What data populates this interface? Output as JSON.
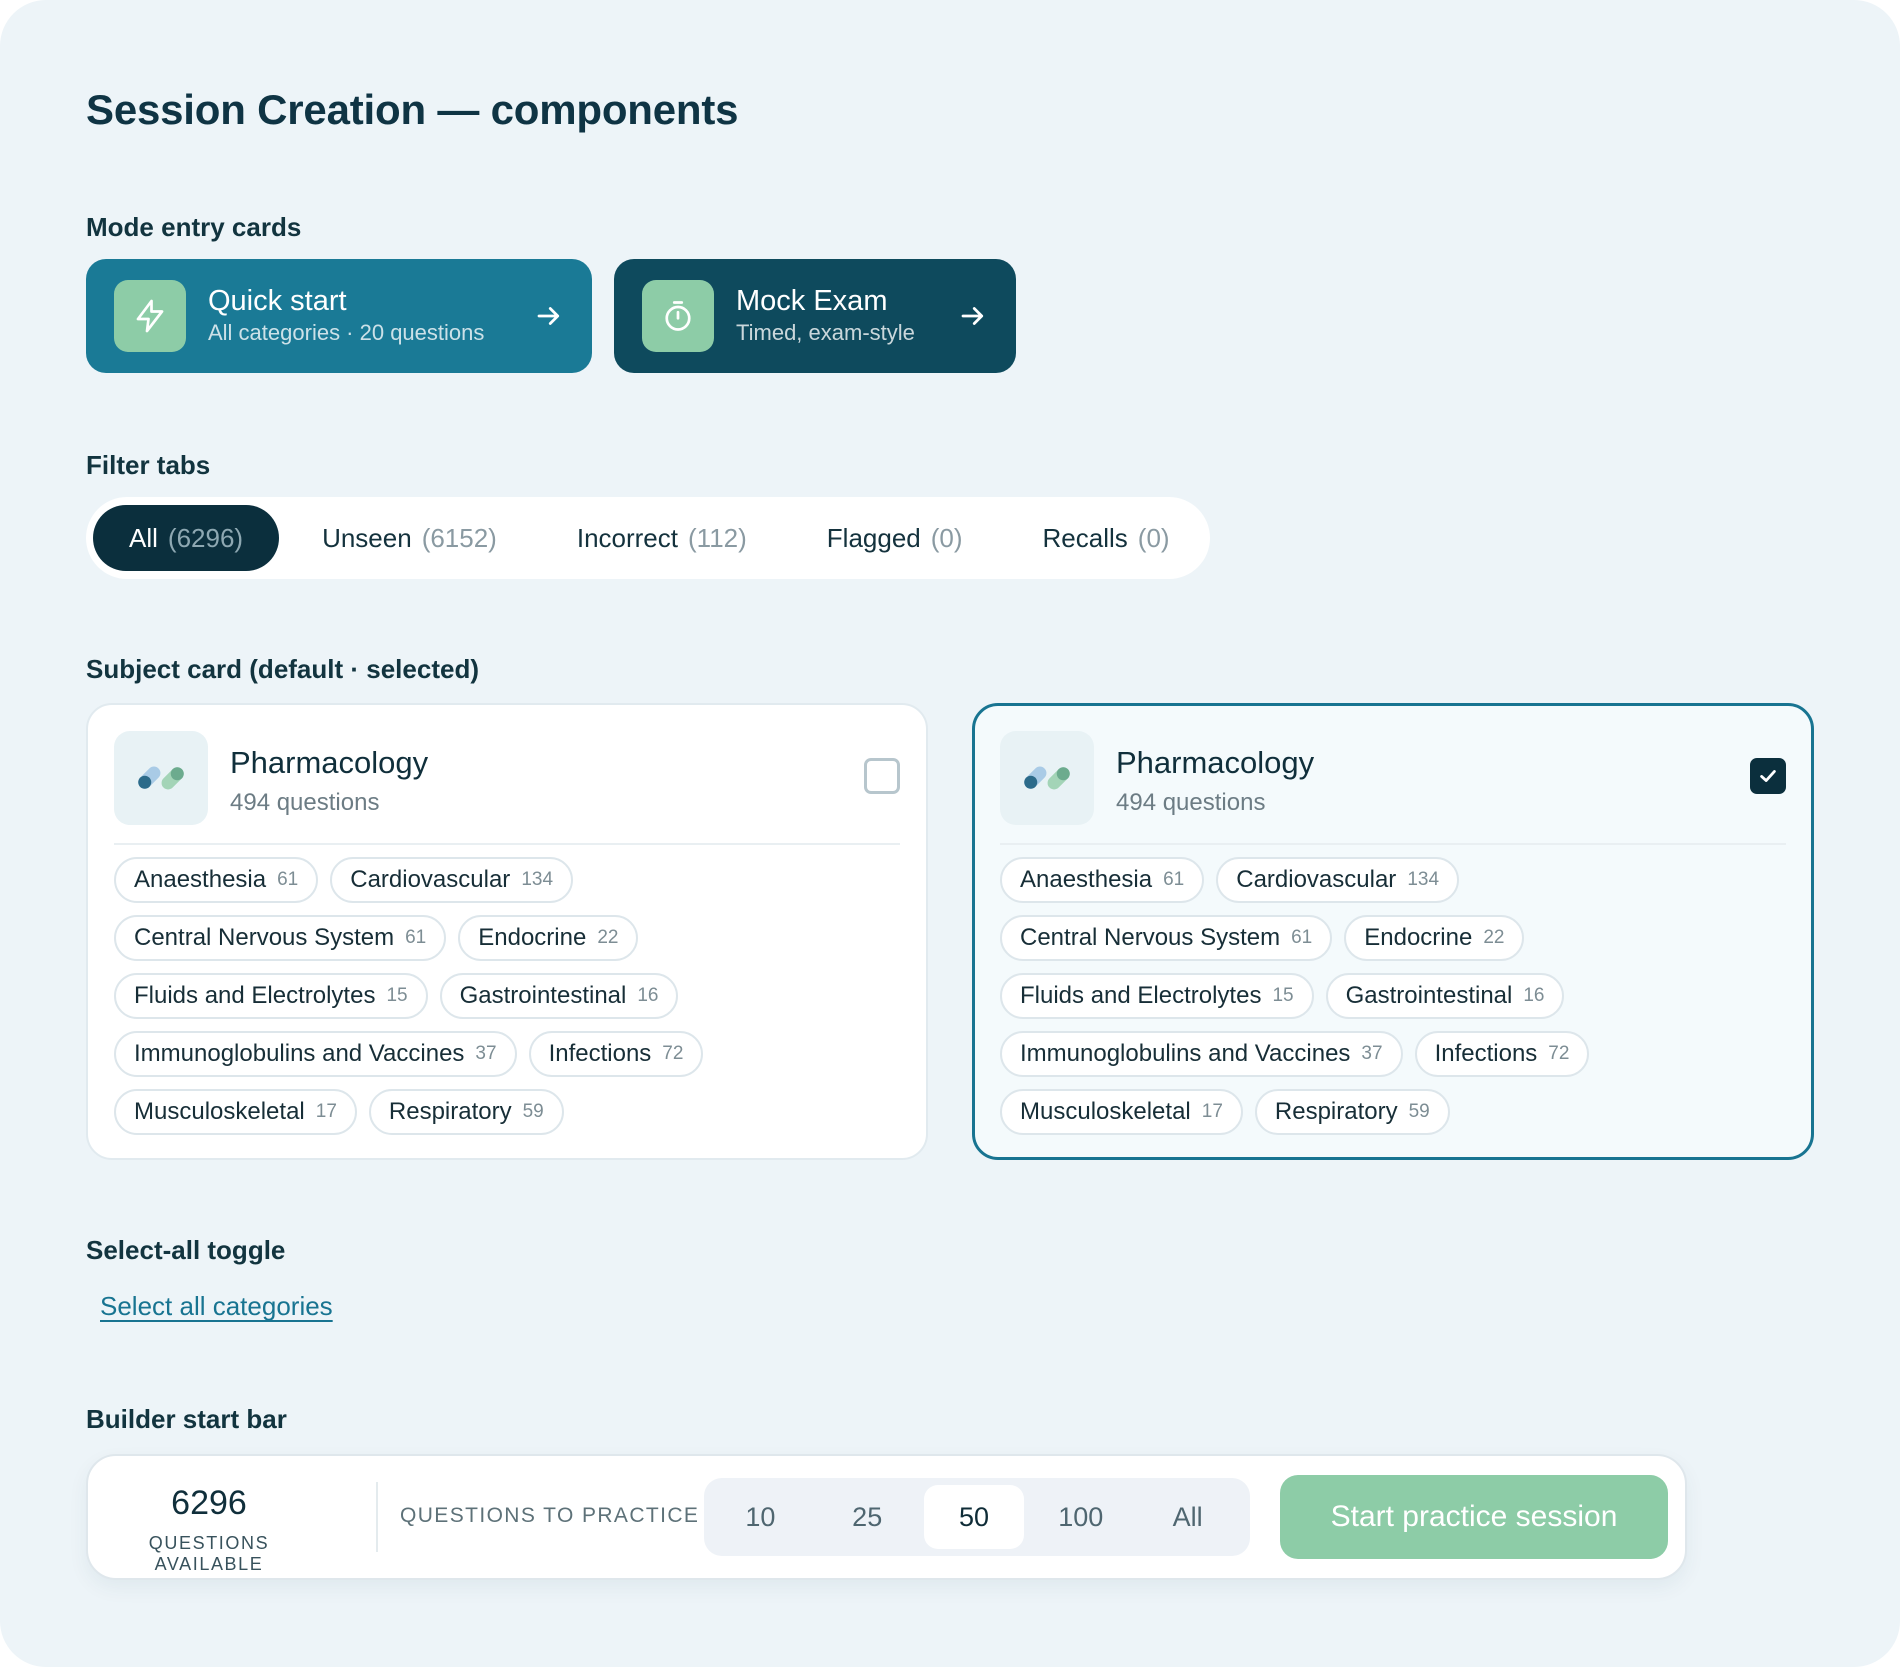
{
  "page": {
    "title": "Session Creation — components"
  },
  "sections": {
    "mode": "Mode entry cards",
    "filters": "Filter tabs",
    "subject": "Subject card  (default · selected)",
    "select_all": "Select-all toggle",
    "builder": "Builder start bar"
  },
  "mode_cards": [
    {
      "title": "Quick start",
      "subtitle": "All categories · 20 questions",
      "icon": "lightning-icon"
    },
    {
      "title": "Mock Exam",
      "subtitle": "Timed, exam-style",
      "icon": "timer-icon"
    }
  ],
  "tabs": [
    {
      "label": "All",
      "count": "(6296)",
      "active": true
    },
    {
      "label": "Unseen",
      "count": "(6152)"
    },
    {
      "label": "Incorrect",
      "count": "(112)"
    },
    {
      "label": "Flagged",
      "count": "(0)"
    },
    {
      "label": "Recalls",
      "count": "(0)"
    }
  ],
  "subject_cards": [
    {
      "name": "Pharmacology",
      "count": "494 questions",
      "selected": false,
      "chips": [
        {
          "label": "Anaesthesia",
          "n": "61"
        },
        {
          "label": "Cardiovascular",
          "n": "134"
        },
        {
          "label": "Central Nervous System",
          "n": "61"
        },
        {
          "label": "Endocrine",
          "n": "22"
        },
        {
          "label": "Fluids and Electrolytes",
          "n": "15"
        },
        {
          "label": "Gastrointestinal",
          "n": "16"
        },
        {
          "label": "Immunoglobulins and Vaccines",
          "n": "37"
        },
        {
          "label": "Infections",
          "n": "72"
        },
        {
          "label": "Musculoskeletal",
          "n": "17"
        },
        {
          "label": "Respiratory",
          "n": "59"
        }
      ]
    },
    {
      "name": "Pharmacology",
      "count": "494 questions",
      "selected": true,
      "chips": [
        {
          "label": "Anaesthesia",
          "n": "61"
        },
        {
          "label": "Cardiovascular",
          "n": "134"
        },
        {
          "label": "Central Nervous System",
          "n": "61"
        },
        {
          "label": "Endocrine",
          "n": "22"
        },
        {
          "label": "Fluids and Electrolytes",
          "n": "15"
        },
        {
          "label": "Gastrointestinal",
          "n": "16"
        },
        {
          "label": "Immunoglobulins and Vaccines",
          "n": "37"
        },
        {
          "label": "Infections",
          "n": "72"
        },
        {
          "label": "Musculoskeletal",
          "n": "17"
        },
        {
          "label": "Respiratory",
          "n": "59"
        }
      ]
    }
  ],
  "select_all_label": "Select all categories",
  "builder": {
    "available_count": "6296",
    "available_label": "QUESTIONS AVAILABLE",
    "practice_label": "QUESTIONS TO PRACTICE",
    "options": [
      "10",
      "25",
      "50",
      "100",
      "All"
    ],
    "selected_option": "50",
    "start_label": "Start practice session"
  },
  "colors": {
    "page_bg": "#edf4f8",
    "quick_card": "#1a7a96",
    "mock_card": "#0e4a5d",
    "accent_green": "#8dcca7",
    "active_tab": "#0b2f3d",
    "selected_border": "#187491"
  }
}
